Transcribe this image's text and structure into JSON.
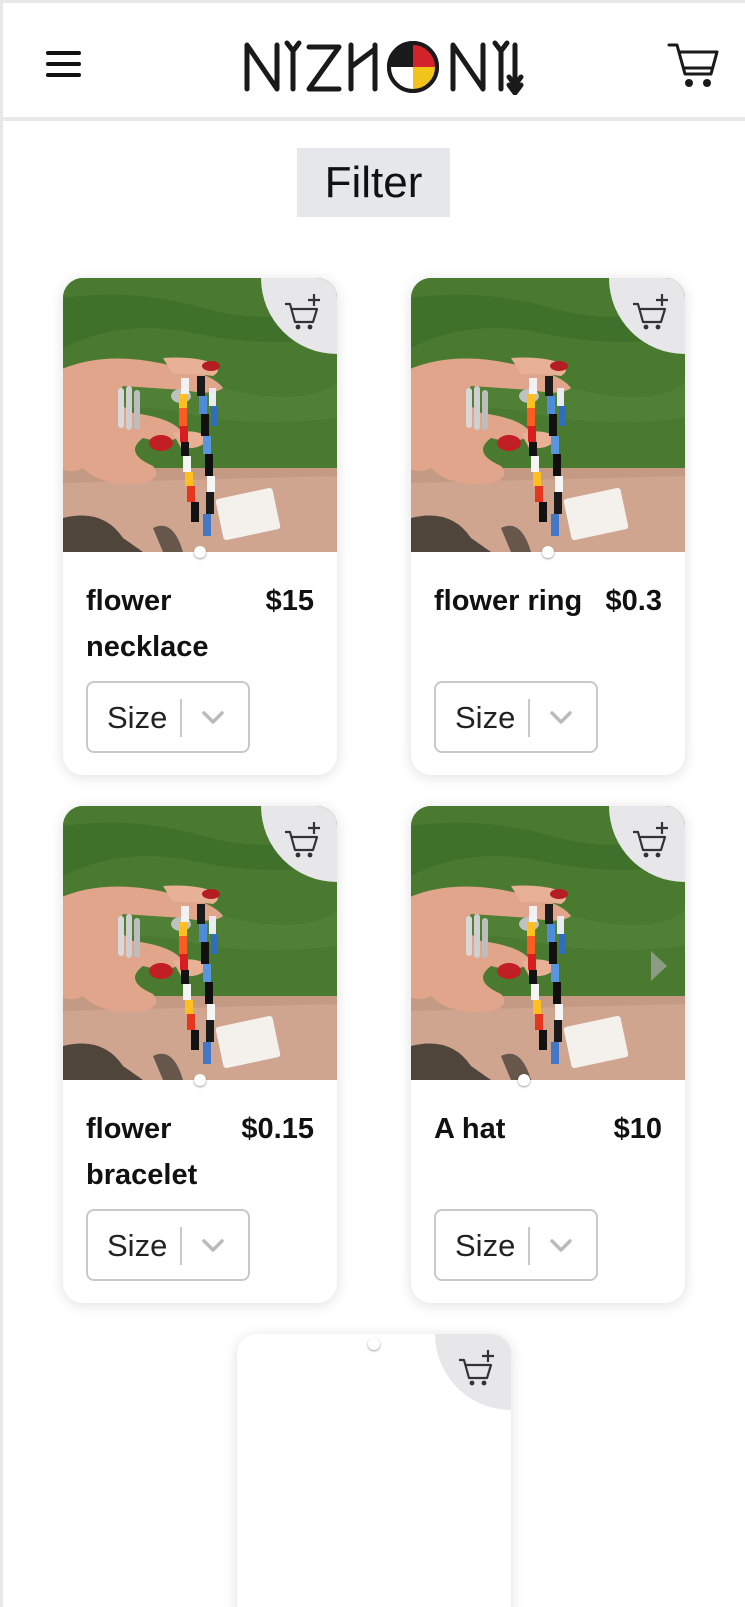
{
  "header": {
    "menu_icon": "hamburger-menu-icon",
    "logo_text": "NIZHONI",
    "cart_icon": "shopping-cart-icon"
  },
  "filter": {
    "label": "Filter"
  },
  "products": [
    {
      "name": "flower necklace",
      "price": "$15",
      "size_label": "Size",
      "cart_icon": "add-to-cart-icon"
    },
    {
      "name": "flower ring",
      "price": "$0.3",
      "size_label": "Size",
      "cart_icon": "add-to-cart-icon"
    },
    {
      "name": "flower bracelet",
      "price": "$0.15",
      "size_label": "Size",
      "cart_icon": "add-to-cart-icon"
    },
    {
      "name": "A hat",
      "price": "$10",
      "size_label": "Size",
      "cart_icon": "add-to-cart-icon"
    },
    {
      "name": "",
      "price": "",
      "size_label": "",
      "cart_icon": "add-to-cart-icon"
    }
  ],
  "colors": {
    "header_border": "#e9e9ea",
    "filter_bg": "#e5e7eb",
    "corner_bg": "#e7e7ea",
    "logo_red": "#d2232a",
    "logo_yellow": "#f2c318"
  }
}
